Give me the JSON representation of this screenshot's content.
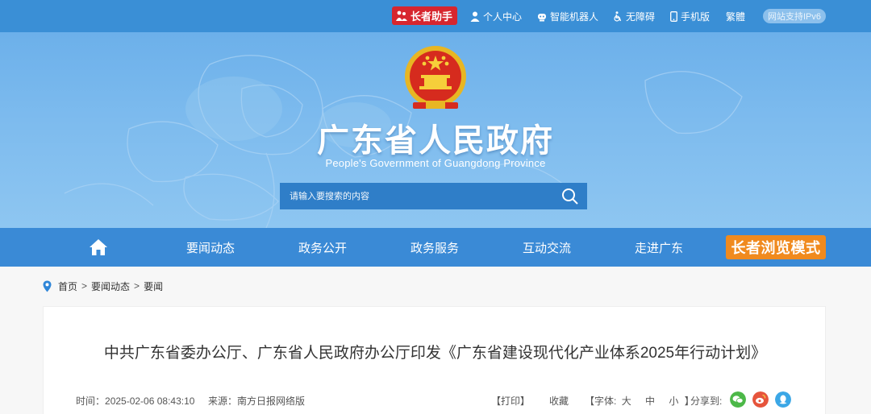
{
  "topbar": {
    "elder_assistant": "长者助手",
    "personal_center": "个人中心",
    "smart_robot": "智能机器人",
    "accessibility": "无障碍",
    "mobile": "手机版",
    "traditional": "繁體",
    "ipv6": "网站支持IPv6"
  },
  "banner": {
    "title": "广东省人民政府",
    "subtitle": "People's Government of Guangdong Province",
    "search_placeholder": "请输入要搜索的内容"
  },
  "nav": {
    "items": [
      "要闻动态",
      "政务公开",
      "政务服务",
      "互动交流",
      "走进广东"
    ],
    "elder_mode": "长者浏览模式"
  },
  "breadcrumb": {
    "home": "首页",
    "level1": "要闻动态",
    "level2": "要闻",
    "separator": ">"
  },
  "article": {
    "title": "中共广东省委办公厅、广东省人民政府办公厅印发《广东省建设现代化产业体系2025年行动计划》",
    "time_label": "时间：",
    "time": "2025-02-06 08:43:10",
    "source_label": "来源：",
    "source": "南方日报网络版",
    "print": "【打印】",
    "favorite": "收藏",
    "font_label": "【字体:",
    "font_large": "大",
    "font_medium": "中",
    "font_small": "小",
    "font_end": "】",
    "share_label": "分享到:"
  },
  "colors": {
    "topbar": "#3a8fd6",
    "nav": "#3a8ad6",
    "elder_badge": "#d7262e",
    "elder_mode": "#f08a1e",
    "wechat": "#4cb848",
    "weibo": "#e6543c",
    "qq": "#3ba7e6"
  }
}
